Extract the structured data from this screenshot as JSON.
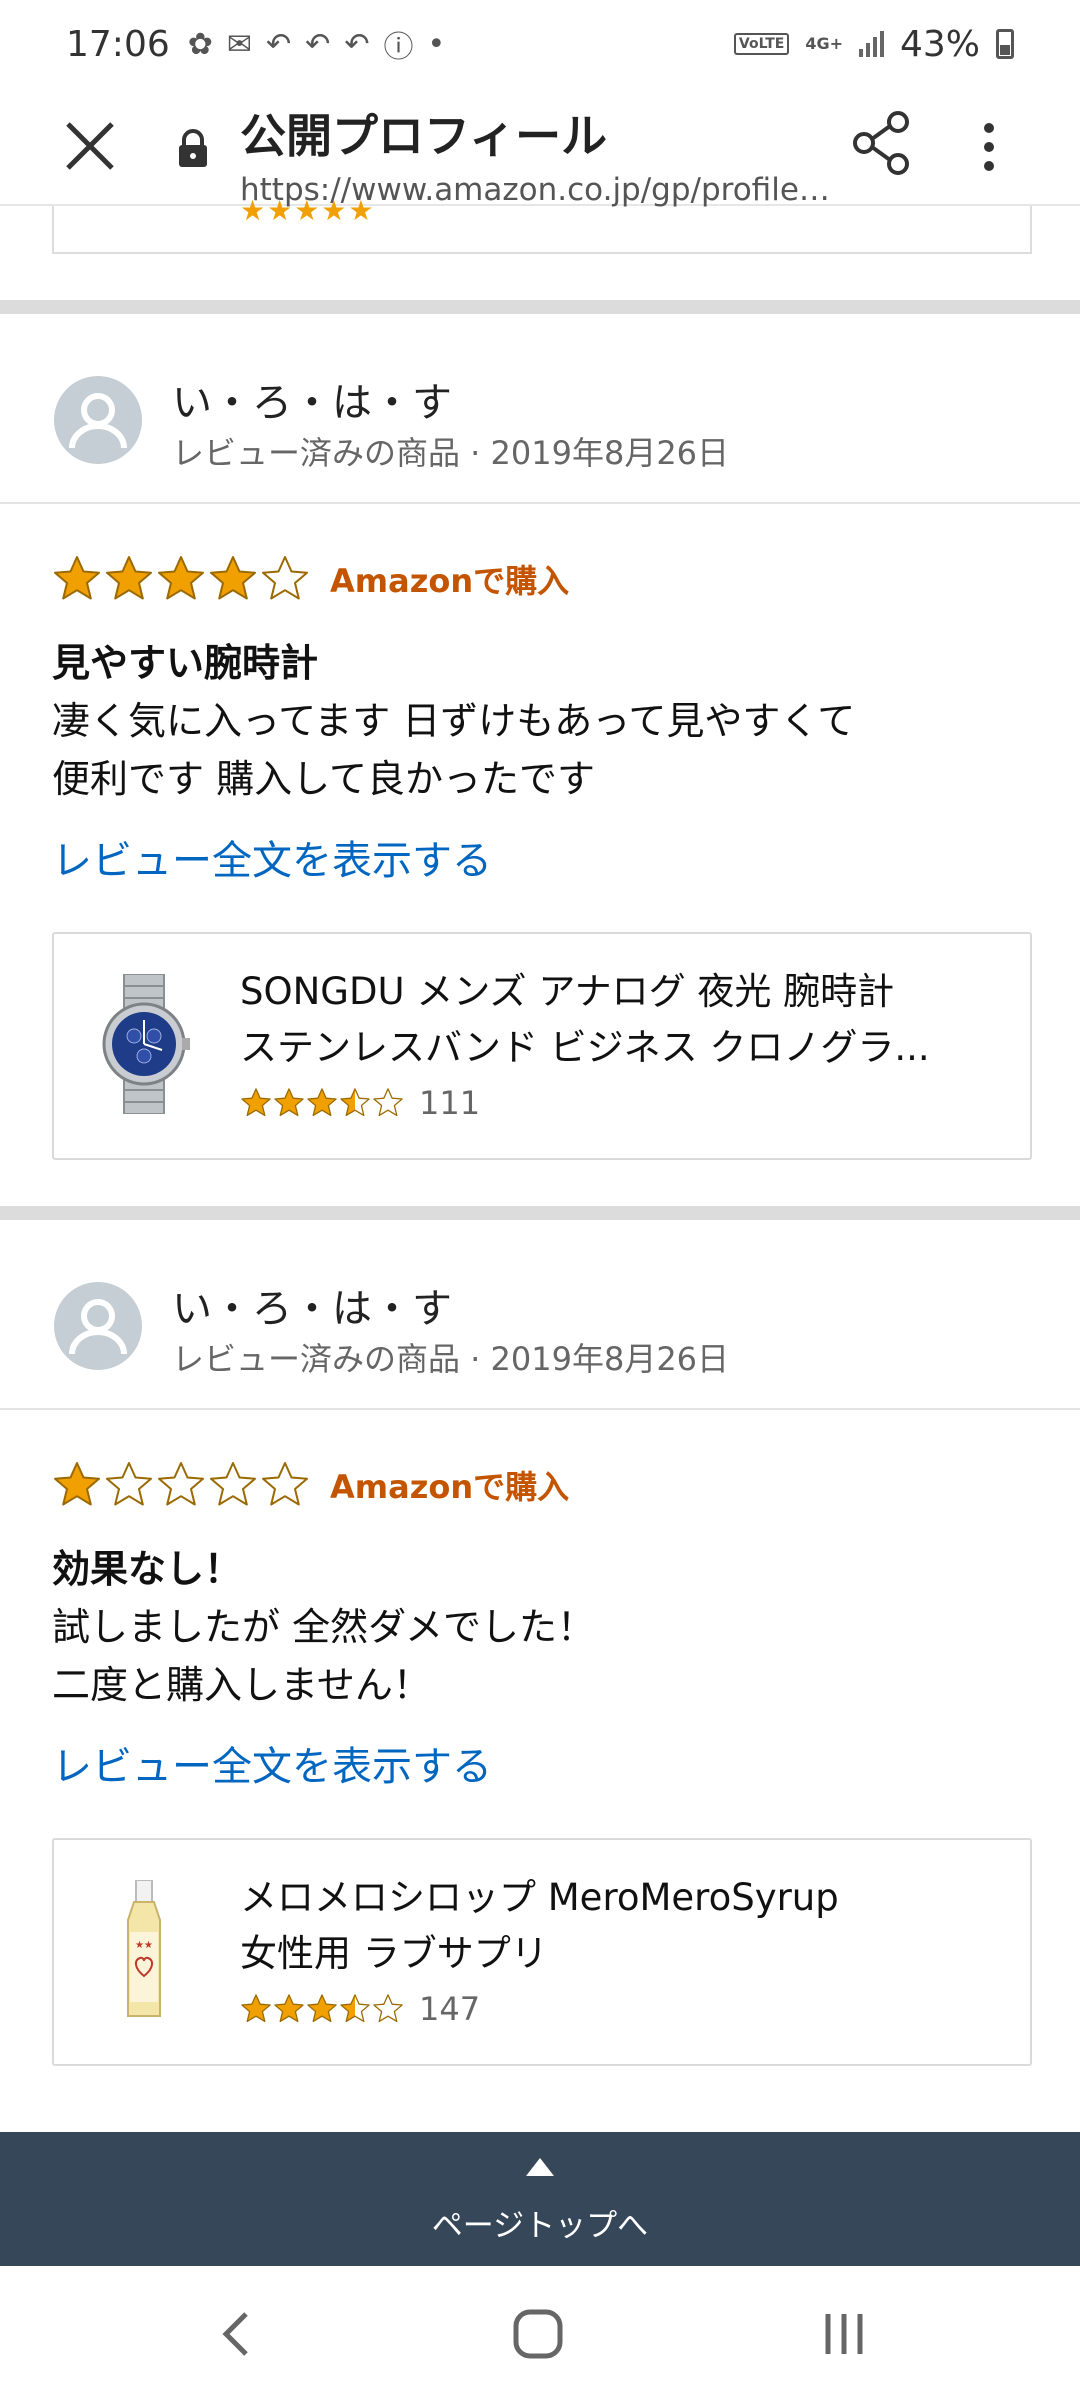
{
  "status_bar": {
    "time": "17:06",
    "network": "4G+",
    "volte": "VoLTE",
    "battery": "43%"
  },
  "browser": {
    "title": "公開プロフィール",
    "url": "https://www.amazon.co.jp/gp/profile/am..."
  },
  "reviews": [
    {
      "author": "い・ろ・は・す",
      "meta": "レビュー済みの商品 · 2019年8月26日",
      "rating": 4,
      "verified": "Amazonで購入",
      "title": "見やすい腕時計",
      "text": "凄く気に入ってます 日ずけもあって見やすくて\n便利です 購入して良かったです",
      "read_more": "レビュー全文を表示する",
      "product": {
        "name_line1": "SONGDU メンズ アナログ 夜光 腕時計",
        "name_line2": "ステンレスバンド ビジネス クロノグラ...",
        "rating": 3.5,
        "rating_count": "111",
        "thumb": "wristwatch-image"
      }
    },
    {
      "author": "い・ろ・は・す",
      "meta": "レビュー済みの商品 · 2019年8月26日",
      "rating": 1,
      "verified": "Amazonで購入",
      "title": "効果なし！",
      "text": "試しましたが 全然ダメでした！\n二度と購入しません！",
      "read_more": "レビュー全文を表示する",
      "product": {
        "name_line1": "メロメロシロップ MeroMeroSyrup",
        "name_line2": "女性用 ラブサプリ",
        "rating": 3.5,
        "rating_count": "147",
        "thumb": "syrup-bottle-image"
      }
    }
  ],
  "back_to_top": "ページトップへ",
  "colors": {
    "star": "#f0a000",
    "verified": "#c45500",
    "link": "#0066c0",
    "footer": "#37475a"
  }
}
